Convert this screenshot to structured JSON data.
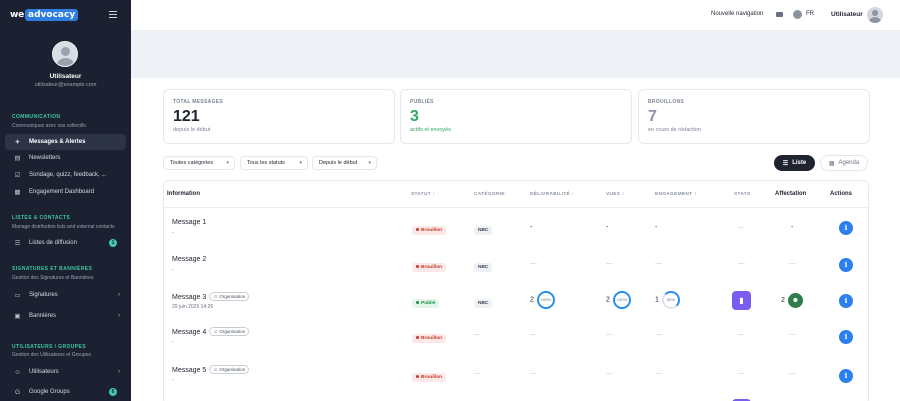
{
  "sidebar": {
    "logo_we": "we",
    "logo_adv": "advocacy",
    "user_name": "Utilisateur",
    "user_email": "utilisateur@example.com",
    "sections": {
      "communication": {
        "title": "COMMUNICATION",
        "subtitle": "Communiquez avec vos collectifs"
      },
      "lists": {
        "title": "LISTES & CONTACTS",
        "subtitle": "Manage distribution lists and external contacts"
      },
      "signatures": {
        "title": "SIGNATURES ET BANNIÈRES",
        "subtitle": "Gestion des Signatures et Bannières"
      },
      "users": {
        "title": "UTILISATEURS / GROUPES",
        "subtitle": "Gestion des Utilisateurs et Groupes"
      }
    },
    "items": {
      "messages": "Messages & Alertes",
      "newsletters": "Newsletters",
      "sondage": "Sondage, quizz, feedback, ...",
      "engagement": "Engagement Dashboard",
      "listes": "Listes de diffusion",
      "listes_badge": "1",
      "signatures": "Signatures",
      "bannieres": "Bannières",
      "utilisateurs": "Utilisateurs",
      "google_groups": "Google Groups",
      "google_groups_badge": "6"
    }
  },
  "topbar": {
    "new_nav": "Nouvelle navigation",
    "lang": "FR",
    "user": "Utilisateur"
  },
  "stats": [
    {
      "label": "TOTAL MESSAGES",
      "value": "121",
      "sub": "depuis le début",
      "color": "#1f2430"
    },
    {
      "label": "PUBLIÉS",
      "value": "3",
      "sub": "actifs et envoyés",
      "color": "#2eaa5c"
    },
    {
      "label": "BROUILLONS",
      "value": "7",
      "sub": "en cours de rédaction",
      "color": "#8a93a3"
    }
  ],
  "filters": {
    "categories": "Toutes catégories",
    "statuses": "Tous les statuts",
    "since": "Depuis le début",
    "view_list": "Liste",
    "view_agenda": "Agenda"
  },
  "table": {
    "headers": {
      "information": "Information",
      "statut": "STATUT ↕",
      "categorie": "CATÉGORIE",
      "delivrabilite": "DÉLIVRABILITÉ ↕",
      "vues": "VUES ↕",
      "engagement": "ENGAGEMENT ↕",
      "stats": "STATS",
      "affectation": "Affectation",
      "actions": "Actions"
    },
    "org_label": "Organisation",
    "rows": [
      {
        "name": "Message 1",
        "sub": "-",
        "status": "Brouillon",
        "category": "NBC",
        "deliv": "-",
        "vues": "-",
        "engagement": "-",
        "stats": "—",
        "affect": "-"
      },
      {
        "name": "Message 2",
        "sub": "-",
        "status": "Brouillon",
        "category": "NBC",
        "deliv": "—",
        "vues": "—",
        "engagement": "—",
        "stats": "—",
        "affect": "—"
      },
      {
        "name": "Message 3",
        "sub": "29 juin 2026 14:26",
        "status": "Publié",
        "category": "NBC",
        "deliv_num": "2",
        "deliv_pct": "100%",
        "vues_num": "2",
        "vues_pct": "100%",
        "eng_num": "1",
        "eng_pct": "50%",
        "affect_num": "2"
      },
      {
        "name": "Message 4",
        "sub": "-",
        "status": "Brouillon",
        "category": "",
        "deliv": "—",
        "vues": "—",
        "engagement": "—",
        "stats": "—",
        "affect": "—"
      },
      {
        "name": "Message 5",
        "sub": "-",
        "status": "Brouillon",
        "category": "",
        "deliv": "—",
        "vues": "—",
        "engagement": "—",
        "stats": "—",
        "affect": "—"
      }
    ]
  }
}
